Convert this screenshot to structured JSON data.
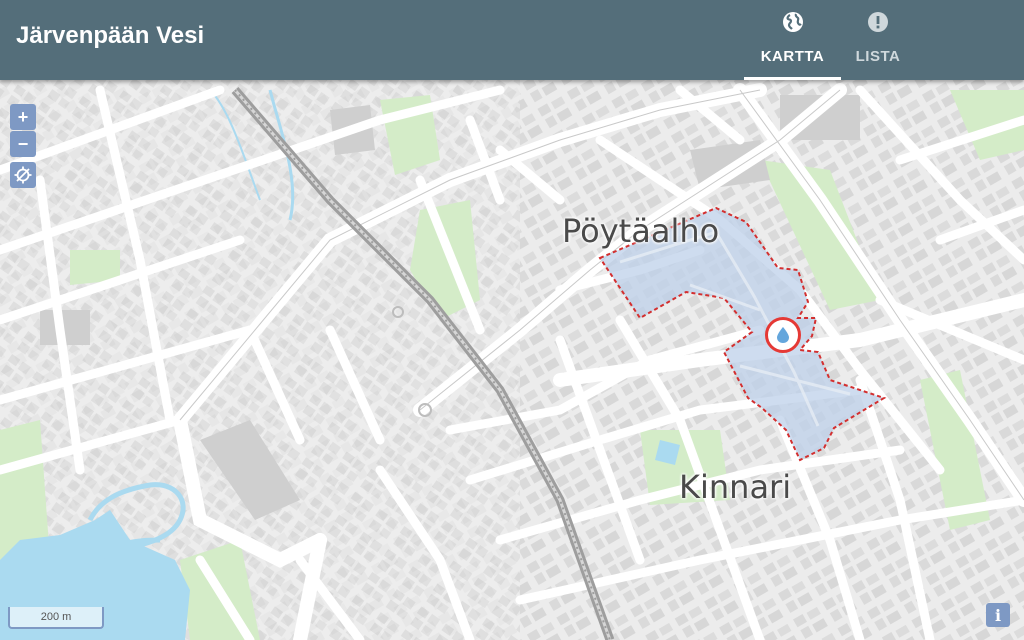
{
  "header": {
    "title": "Järvenpään Vesi",
    "tabs": [
      {
        "label": "KARTTA",
        "icon": "globe-icon",
        "active": true
      },
      {
        "label": "LISTA",
        "icon": "alert-circle-icon",
        "active": false
      }
    ],
    "background": "#546e7a"
  },
  "map": {
    "places": [
      {
        "name": "Pöytäalho"
      },
      {
        "name": "Kinnari"
      }
    ],
    "controls": {
      "zoom_in": "+",
      "zoom_out": "−",
      "locate_icon": "locate-icon"
    },
    "scale": "200 m",
    "info": "i",
    "area": {
      "fill": "#bdd0ea",
      "stroke": "#d32f2f",
      "style": "dashed"
    },
    "marker_icon": "water-drop-icon"
  }
}
